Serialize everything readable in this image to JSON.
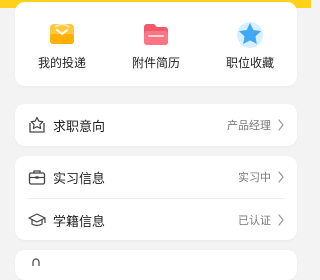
{
  "quick_actions": [
    {
      "label": "我的投递",
      "icon": "inbox-icon",
      "color": "#ffc83d"
    },
    {
      "label": "附件简历",
      "icon": "folder-icon",
      "color": "#f05a6a"
    },
    {
      "label": "职位收藏",
      "icon": "star-icon",
      "color": "#3fa9f5"
    }
  ],
  "job_intent": {
    "title": "求职意向",
    "value": "产品经理",
    "icon": "star-box-icon"
  },
  "internship": {
    "title": "实习信息",
    "value": "实习中",
    "icon": "briefcase-icon"
  },
  "education": {
    "title": "学籍信息",
    "value": "已认证",
    "icon": "graduation-cap-icon"
  },
  "colors": {
    "accent": "#ffd11a",
    "background": "#f3f3f3",
    "muted_text": "#777777"
  }
}
